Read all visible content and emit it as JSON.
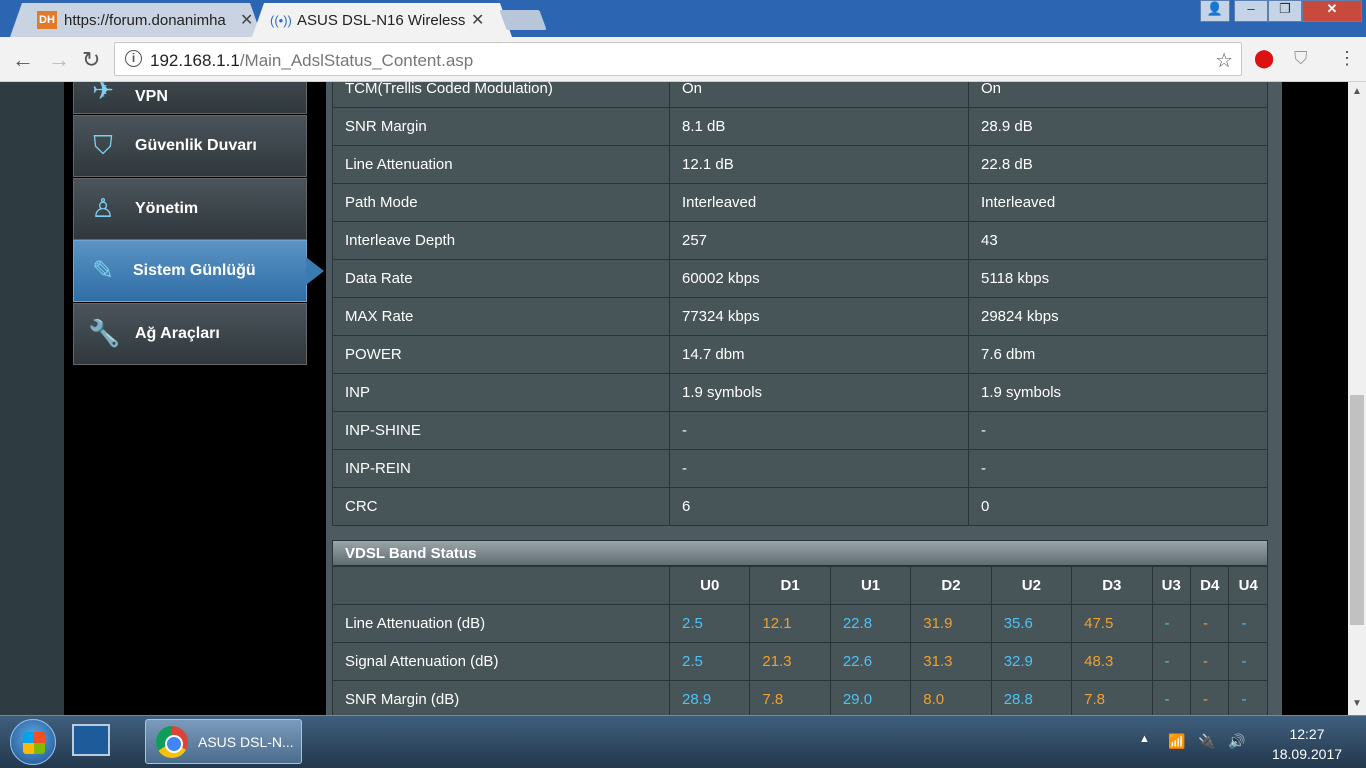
{
  "browser": {
    "tabs": [
      {
        "title": "https://forum.donanimha",
        "favicon": "DH"
      },
      {
        "title": "ASUS DSL-N16 Wireless-",
        "favicon": "asus-wifi-icon"
      }
    ],
    "url_host": "192.168.1.1",
    "url_path": "/Main_AdslStatus_Content.asp"
  },
  "sidebar": {
    "items": [
      {
        "label": "VPN"
      },
      {
        "label": "Güvenlik Duvarı"
      },
      {
        "label": "Yönetim"
      },
      {
        "label": "Sistem Günlüğü",
        "active": true
      },
      {
        "label": "Ağ Araçları"
      }
    ]
  },
  "status": {
    "rows": [
      {
        "name": "TCM(Trellis Coded Modulation)",
        "down": "On",
        "up": "On"
      },
      {
        "name": "SNR Margin",
        "down": "8.1 dB",
        "up": "28.9 dB"
      },
      {
        "name": "Line Attenuation",
        "down": "12.1 dB",
        "up": "22.8 dB"
      },
      {
        "name": "Path Mode",
        "down": "Interleaved",
        "up": "Interleaved"
      },
      {
        "name": "Interleave Depth",
        "down": "257",
        "up": "43"
      },
      {
        "name": "Data Rate",
        "down": "60002 kbps",
        "up": "5118 kbps"
      },
      {
        "name": "MAX Rate",
        "down": "77324 kbps",
        "up": "29824 kbps"
      },
      {
        "name": "POWER",
        "down": "14.7 dbm",
        "up": "7.6 dbm"
      },
      {
        "name": "INP",
        "down": "1.9 symbols",
        "up": "1.9 symbols"
      },
      {
        "name": "INP-SHINE",
        "down": "-",
        "up": "-"
      },
      {
        "name": "INP-REIN",
        "down": "-",
        "up": "-"
      },
      {
        "name": "CRC",
        "down": "6",
        "up": "0"
      }
    ]
  },
  "vdsl": {
    "title": "VDSL Band Status",
    "bands": [
      "U0",
      "D1",
      "U1",
      "D2",
      "U2",
      "D3",
      "U3",
      "D4",
      "U4"
    ],
    "rows": [
      {
        "name": "Line Attenuation (dB)",
        "values": [
          "2.5",
          "12.1",
          "22.8",
          "31.9",
          "35.6",
          "47.5",
          "-",
          "-",
          "-"
        ]
      },
      {
        "name": "Signal Attenuation (dB)",
        "values": [
          "2.5",
          "21.3",
          "22.6",
          "31.3",
          "32.9",
          "48.3",
          "-",
          "-",
          "-"
        ]
      },
      {
        "name": "SNR Margin (dB)",
        "values": [
          "28.9",
          "7.8",
          "29.0",
          "8.0",
          "28.8",
          "7.8",
          "-",
          "-",
          "-"
        ]
      }
    ]
  },
  "taskbar": {
    "chrome_label": "ASUS DSL-N...",
    "time": "12:27",
    "date": "18.09.2017"
  }
}
